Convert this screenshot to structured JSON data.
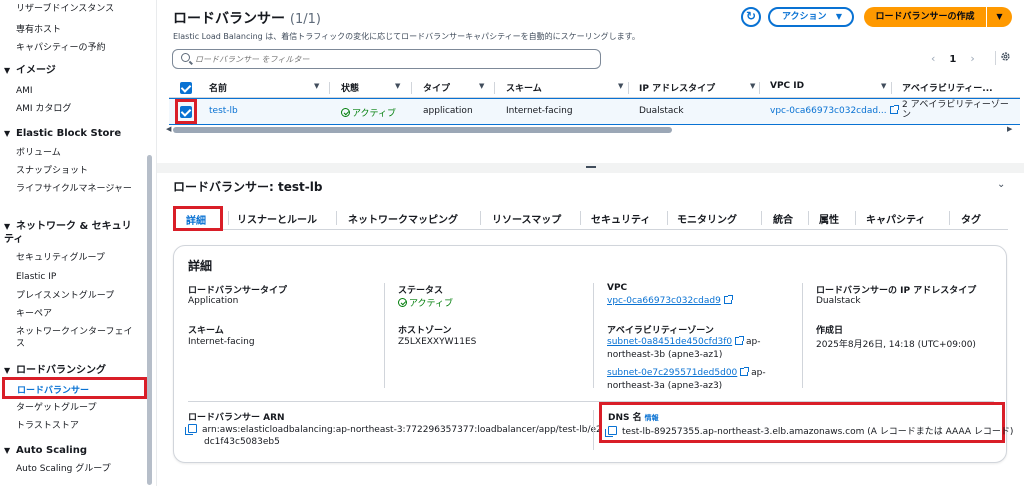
{
  "sidebar": {
    "items_top": [
      "リザーブドインスタンス",
      "専有ホスト",
      "キャパシティーの予約"
    ],
    "section_images": "イメージ",
    "images_items": [
      "AMI",
      "AMI カタログ"
    ],
    "section_ebs": "Elastic Block Store",
    "ebs_items": [
      "ボリューム",
      "スナップショット",
      "ライフサイクルマネージャー"
    ],
    "section_network": "ネットワーク & セキュリティ",
    "network_items": [
      "セキュリティグループ",
      "Elastic IP",
      "プレイスメントグループ",
      "キーペア",
      "ネットワークインターフェイス"
    ],
    "section_lb": "ロードバランシング",
    "lb_items": [
      "ロードバランサー",
      "ターゲットグループ",
      "トラストストア"
    ],
    "section_as": "Auto Scaling",
    "as_items": [
      "Auto Scaling グループ"
    ]
  },
  "header": {
    "title": "ロードバランサー",
    "count": "(1/1)",
    "subtitle": "Elastic Load Balancing は、着信トラフィックの変化に応じてロードバランサーキャパシティーを自動的にスケーリングします。",
    "action_label": "アクション",
    "create_label": "ロードバランサーの作成"
  },
  "filter": {
    "placeholder": "ロードバランサー をフィルター"
  },
  "pager": {
    "page": "1"
  },
  "table": {
    "columns": [
      "名前",
      "状態",
      "タイプ",
      "スキーム",
      "IP アドレスタイプ",
      "VPC ID",
      "アベイラビリティー..."
    ],
    "row": {
      "name": "test-lb",
      "state": "アクティブ",
      "type": "application",
      "scheme": "Internet-facing",
      "ip_type": "Dualstack",
      "vpc": "vpc-0ca66973c032cdad...",
      "az_line1": "2 アベイラビリティーゾー",
      "az_line2": "ン"
    }
  },
  "detail": {
    "title": "ロードバランサー: test-lb",
    "tabs": [
      "詳細",
      "リスナーとルール",
      "ネットワークマッピング",
      "リソースマップ",
      "セキュリティ",
      "モニタリング",
      "統合",
      "属性",
      "キャパシティ",
      "タグ"
    ],
    "card_title": "詳細",
    "lb_type_label": "ロードバランサータイプ",
    "lb_type_value": "Application",
    "status_label": "ステータス",
    "status_value": "アクティブ",
    "vpc_label": "VPC",
    "vpc_value": "vpc-0ca66973c032cdad9",
    "ip_label": "ロードバランサーの IP アドレスタイプ",
    "ip_value": "Dualstack",
    "scheme_label": "スキーム",
    "scheme_value": "Internet-facing",
    "zone_label": "ホストゾーン",
    "zone_value": "Z5LXEXXYW11ES",
    "az_label": "アベイラビリティーゾーン",
    "az1_link": "subnet-0a8451de450cfd3f0",
    "az1_tail": "ap-",
    "az1_line2": "northeast-3b (apne3-az1)",
    "az2_link": "subnet-0e7c295571ded5d00",
    "az2_tail": "ap-",
    "az2_line2": "northeast-3a (apne3-az3)",
    "created_label": "作成日",
    "created_value": "2025年8月26日, 14:18 (UTC+09:00)",
    "arn_label": "ロードバランサー ARN",
    "arn_line1": "arn:aws:elasticloadbalancing:ap-northeast-3:772296357377:loadbalancer/app/test-lb/e2",
    "arn_line2": "dc1f43c5083eb5",
    "dns_label": "DNS 名",
    "dns_info": "情報",
    "dns_value": "test-lb-89257355.ap-northeast-3.elb.amazonaws.com (A レコードまたは AAAA レコード)"
  },
  "colors": {
    "accent": "#0972d3",
    "highlight": "#d91e28",
    "primary_button": "#ff9900",
    "success": "#037f0c"
  }
}
